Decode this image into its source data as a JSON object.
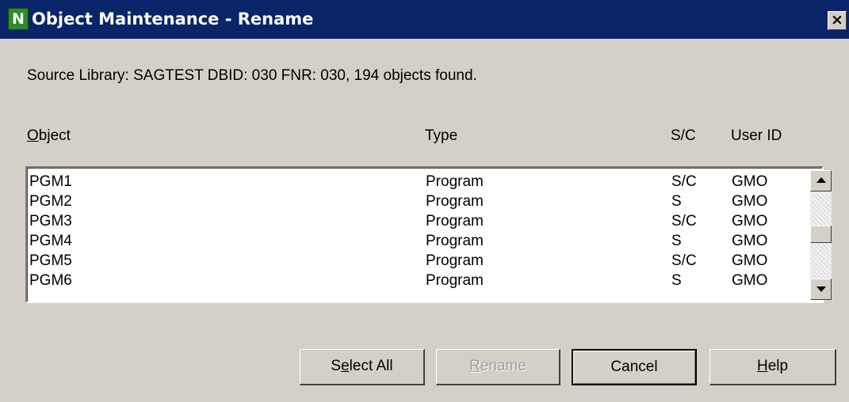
{
  "window": {
    "icon_letter": "N",
    "title": "Object Maintenance - Rename",
    "close_glyph": "×"
  },
  "info": {
    "text": "Source Library: SAGTEST  DBID: 030  FNR: 030, 194 objects found."
  },
  "columns": {
    "object": {
      "ul": "O",
      "rest": "bject"
    },
    "type": "Type",
    "sc": "S/C",
    "user_id": "User ID"
  },
  "rows": [
    {
      "object": "PGM1",
      "type": "Program",
      "sc": "S/C",
      "user_id": "GMO"
    },
    {
      "object": "PGM2",
      "type": "Program",
      "sc": "S",
      "user_id": "GMO"
    },
    {
      "object": "PGM3",
      "type": "Program",
      "sc": "S/C",
      "user_id": "GMO"
    },
    {
      "object": "PGM4",
      "type": "Program",
      "sc": "S",
      "user_id": "GMO"
    },
    {
      "object": "PGM5",
      "type": "Program",
      "sc": "S/C",
      "user_id": "GMO"
    },
    {
      "object": "PGM6",
      "type": "Program",
      "sc": "S",
      "user_id": "GMO"
    }
  ],
  "scrollbar": {
    "up_icon": "scroll-up-arrow",
    "down_icon": "scroll-down-arrow"
  },
  "buttons": {
    "select_all": {
      "pre": "S",
      "ul": "e",
      "post": "lect All"
    },
    "rename": {
      "pre": "",
      "ul": "R",
      "post": "ename",
      "disabled": true
    },
    "cancel": {
      "label": "Cancel"
    },
    "help": {
      "pre": "",
      "ul": "H",
      "post": "elp"
    }
  }
}
